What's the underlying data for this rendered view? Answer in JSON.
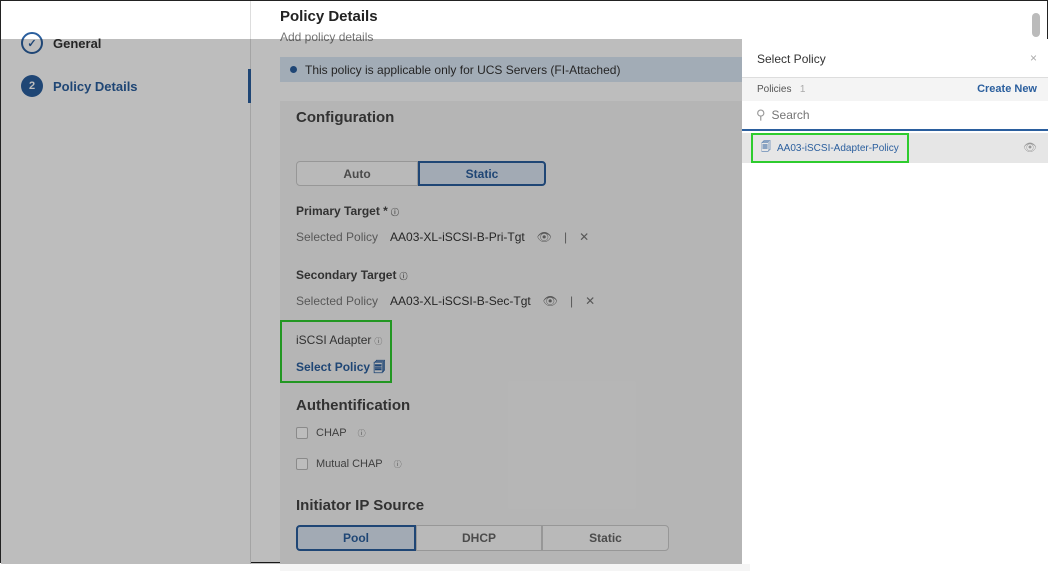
{
  "sidebar": {
    "steps": [
      {
        "num": "",
        "label": "General"
      },
      {
        "num": "2",
        "label": "Policy Details"
      }
    ]
  },
  "header": {
    "title": "Policy Details",
    "subtitle": "Add policy details"
  },
  "banner": "This policy is applicable only for UCS Servers (FI-Attached)",
  "config": {
    "title": "Configuration",
    "modes": [
      "Auto",
      "Static"
    ],
    "primary": {
      "label": "Primary Target *",
      "selected_label": "Selected Policy",
      "value": "AA03-XL-iSCSI-B-Pri-Tgt"
    },
    "secondary": {
      "label": "Secondary Target",
      "selected_label": "Selected Policy",
      "value": "AA03-XL-iSCSI-B-Sec-Tgt"
    },
    "adapter": {
      "label": "iSCSI Adapter",
      "action": "Select Policy"
    },
    "auth": {
      "title": "Authentification",
      "options": [
        "CHAP",
        "Mutual CHAP"
      ]
    },
    "initiator": {
      "title": "Initiator IP Source",
      "options": [
        "Pool",
        "DHCP",
        "Static"
      ]
    }
  },
  "panel": {
    "title": "Select Policy",
    "close": "×",
    "policies_label": "Policies",
    "count": "1",
    "create": "Create New",
    "search_placeholder": "Search",
    "items": [
      "AA03-iSCSI-Adapter-Policy"
    ]
  }
}
